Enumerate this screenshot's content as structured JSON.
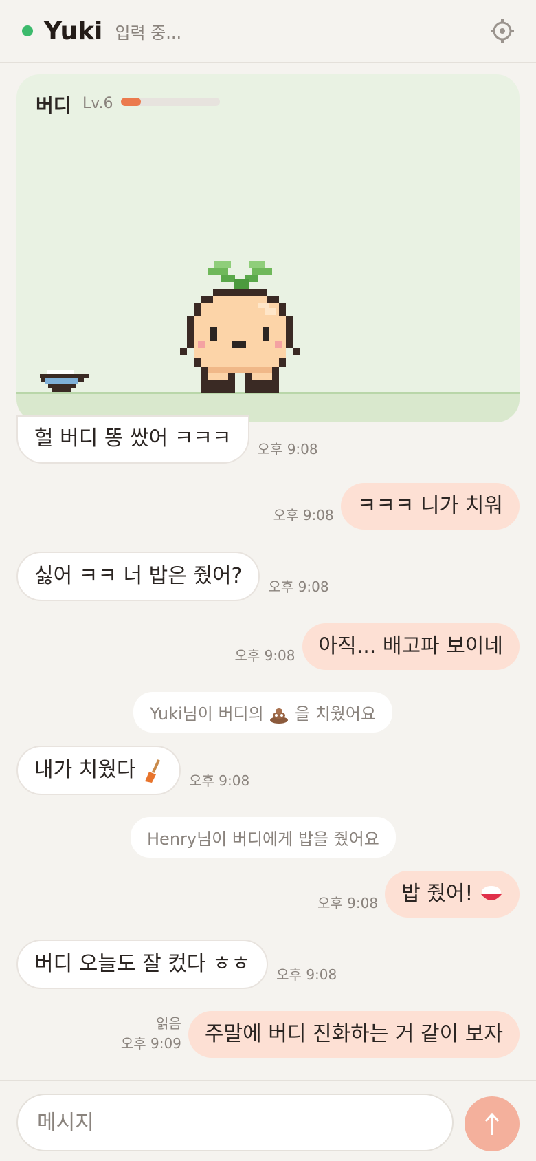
{
  "header": {
    "name": "Yuki",
    "status": "입력 중...",
    "status_color": "#3cba6c",
    "settings_icon": "gear-icon"
  },
  "pet": {
    "name": "버디",
    "level": "Lv.6",
    "xp_progress": 0.2,
    "icons": [
      "turnip-pet-sprite",
      "rice-bowl-icon"
    ]
  },
  "messages": [
    {
      "side": "in",
      "text": "헐 버디 똥 쌌어 ㅋㅋㅋ",
      "time": "오후 9:08"
    },
    {
      "side": "out",
      "text": "ㅋㅋㅋ 니가 치워",
      "time": "오후 9:08"
    },
    {
      "side": "in",
      "text": "싫어 ㅋㅋ 너 밥은 줬어?",
      "time": "오후 9:08"
    },
    {
      "side": "out",
      "text": "아직... 배고파 보이네",
      "time": "오후 9:08"
    },
    {
      "side": "system",
      "text_before": "Yuki님이 버디의",
      "text_after": "을 치웠어요",
      "icon": "poop-icon"
    },
    {
      "side": "in",
      "text": "내가 치웠다",
      "icon": "broom-icon",
      "time": "오후 9:08"
    },
    {
      "side": "system",
      "text": "Henry님이 버디에게 밥을 줬어요"
    },
    {
      "side": "out",
      "text": "밥 줬어!",
      "icon": "rice-icon",
      "time": "오후 9:08"
    },
    {
      "side": "in",
      "text": "버디 오늘도 잘 컸다 ㅎㅎ",
      "time": "오후 9:08"
    },
    {
      "side": "out",
      "text": "주말에 버디 진화하는 거 같이 보자",
      "time": "오후 9:09",
      "read": "읽음"
    }
  ],
  "composer": {
    "placeholder": "메시지",
    "send_icon": "send-arrow-icon"
  },
  "colors": {
    "accent": "#eb7a4d",
    "outgoing_bubble": "#fde0d4",
    "send_button": "#f4b09c",
    "pet_background": "#e9f2e3"
  }
}
